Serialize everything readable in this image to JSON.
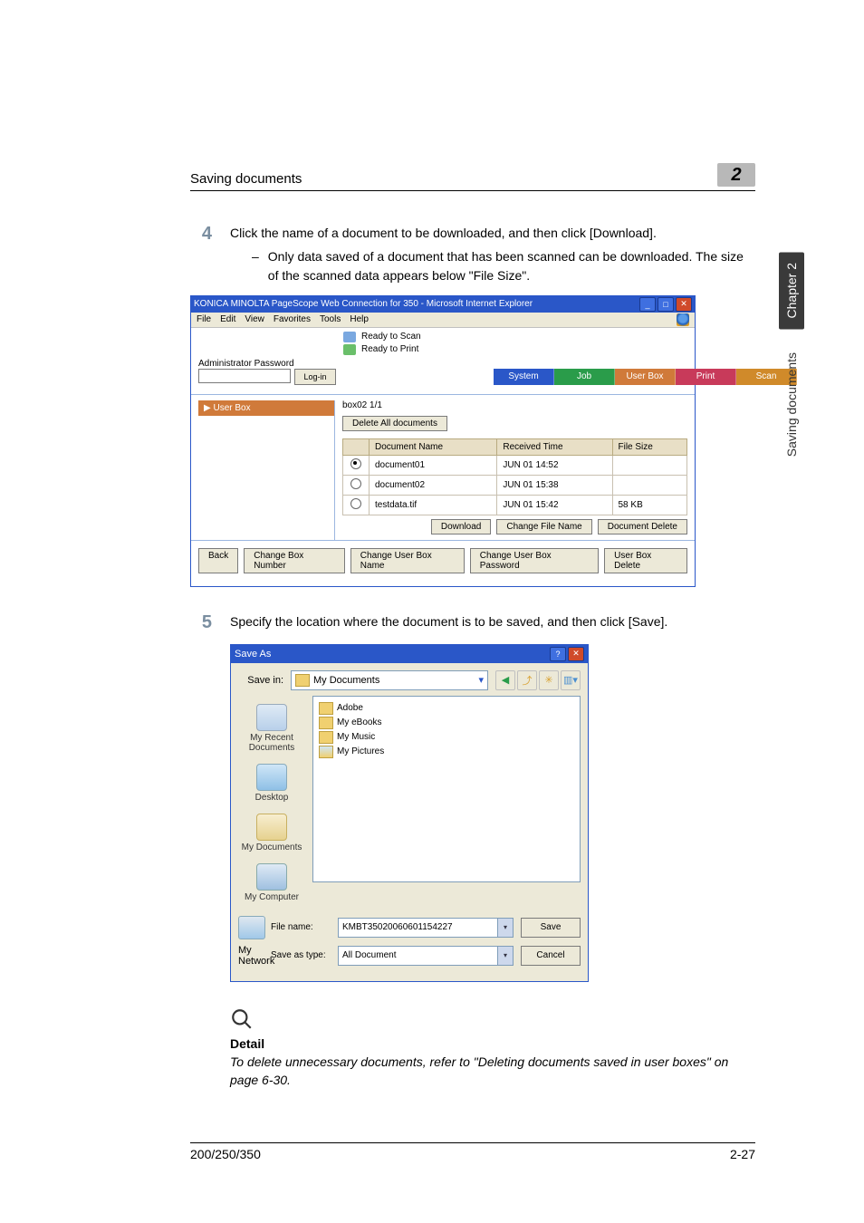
{
  "header": {
    "section_title": "Saving documents",
    "chapter_badge": "2"
  },
  "side_tab": {
    "dark": "Chapter 2",
    "light": "Saving documents"
  },
  "steps": {
    "s4": {
      "num": "4",
      "text": "Click the name of a document to be downloaded, and then click [Download].",
      "sub": "Only data saved of a document that has been scanned can be downloaded. The size of the scanned data appears below \"File Size\"."
    },
    "s5": {
      "num": "5",
      "text": "Specify the location where the document is to be saved, and then click [Save]."
    }
  },
  "screenshot1": {
    "window_title": "KONICA MINOLTA PageScope Web Connection for 350 - Microsoft Internet Explorer",
    "menus": [
      "File",
      "Edit",
      "View",
      "Favorites",
      "Tools",
      "Help"
    ],
    "status": {
      "scan": "Ready to Scan",
      "print": "Ready to Print"
    },
    "admin": {
      "label": "Administrator Password",
      "login": "Log-in"
    },
    "tabs": {
      "system": "System",
      "job": "Job",
      "userbox": "User Box",
      "print": "Print",
      "scan": "Scan"
    },
    "side_header": "▶ User Box",
    "box_label": "box02  1/1",
    "delete_all": "Delete All documents",
    "columns": {
      "name": "Document Name",
      "time": "Received Time",
      "size": "File Size"
    },
    "rows": [
      {
        "selected": true,
        "name": "document01",
        "time": "JUN 01 14:52",
        "size": ""
      },
      {
        "selected": false,
        "name": "document02",
        "time": "JUN 01 15:38",
        "size": ""
      },
      {
        "selected": false,
        "name": "testdata.tif",
        "time": "JUN 01 15:42",
        "size": "58 KB"
      }
    ],
    "actions": {
      "download": "Download",
      "change_file": "Change File Name",
      "doc_delete": "Document Delete"
    },
    "bottom": {
      "back": "Back",
      "change_num": "Change Box Number",
      "change_name": "Change User Box Name",
      "change_pw": "Change User Box Password",
      "ub_delete": "User Box Delete"
    }
  },
  "screenshot2": {
    "title": "Save As",
    "save_in_label": "Save in:",
    "save_in_value": "My Documents",
    "toolbar_icons": [
      "back-icon",
      "up-icon",
      "new-folder-icon",
      "views-icon"
    ],
    "places": {
      "recent": "My Recent Documents",
      "desktop": "Desktop",
      "docs": "My Documents",
      "computer": "My Computer",
      "network": "My Network"
    },
    "folders": [
      "Adobe",
      "My eBooks",
      "My Music",
      "My Pictures"
    ],
    "file_name_label": "File name:",
    "file_name_value": "KMBT35020060601154227",
    "save_type_label": "Save as type:",
    "save_type_value": "All Document",
    "save_btn": "Save",
    "cancel_btn": "Cancel"
  },
  "detail": {
    "heading": "Detail",
    "text": "To delete unnecessary documents, refer to \"Deleting documents saved in user boxes\" on page 6-30."
  },
  "footer": {
    "left": "200/250/350",
    "right": "2-27"
  }
}
